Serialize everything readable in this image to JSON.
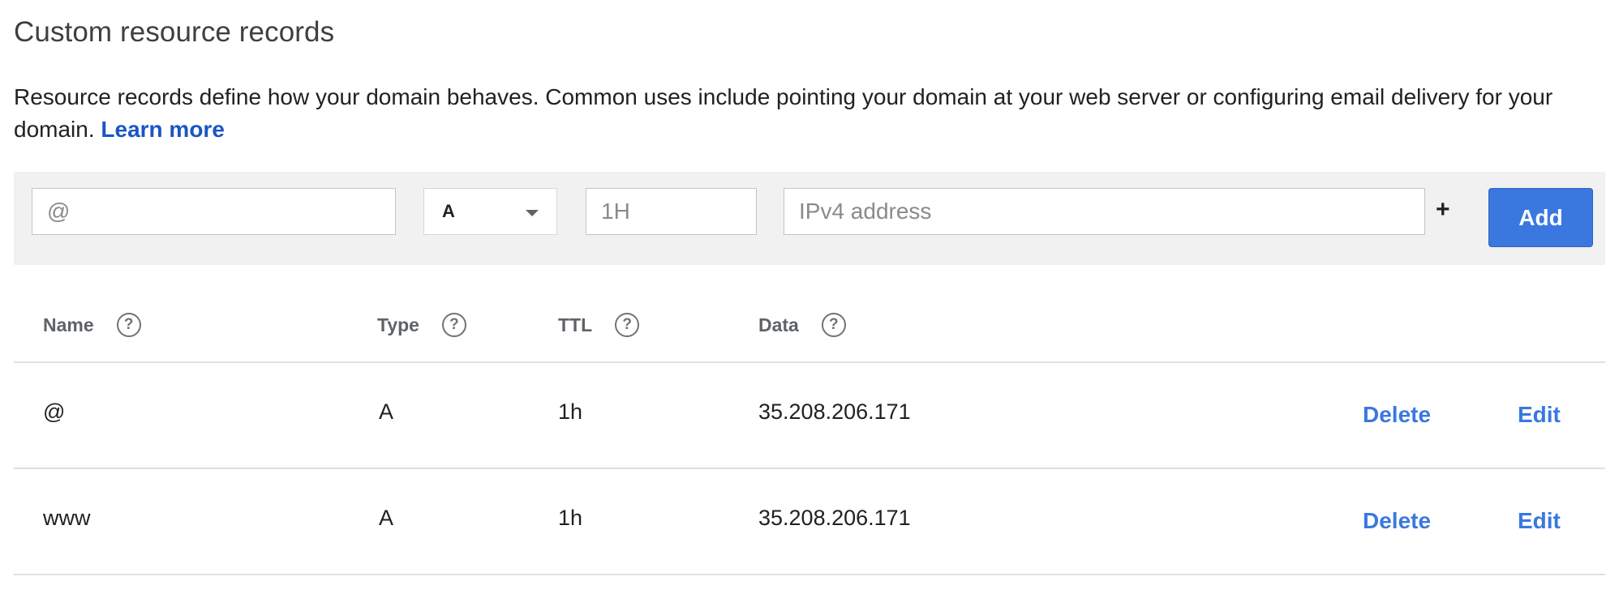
{
  "section": {
    "title": "Custom resource records",
    "description": "Resource records define how your domain behaves. Common uses include pointing your domain at your web server or configuring email delivery for your domain.",
    "learn_more": "Learn more"
  },
  "form": {
    "name_placeholder": "@",
    "type_selected": "A",
    "ttl_placeholder": "1H",
    "data_placeholder": "IPv4 address",
    "plus_label": "+",
    "add_label": "Add"
  },
  "table": {
    "headers": {
      "name": "Name",
      "type": "Type",
      "ttl": "TTL",
      "data": "Data",
      "help_glyph": "?"
    },
    "rows": [
      {
        "name": "@",
        "type": "A",
        "ttl": "1h",
        "data": "35.208.206.171",
        "delete": "Delete",
        "edit": "Edit"
      },
      {
        "name": "www",
        "type": "A",
        "ttl": "1h",
        "data": "35.208.206.171",
        "delete": "Delete",
        "edit": "Edit"
      }
    ]
  },
  "icons": {
    "help": "help-circle-icon",
    "dropdown": "caret-down-icon",
    "add_row": "plus-icon"
  },
  "colors": {
    "link": "#1a56c4",
    "action_link": "#3a78e0",
    "primary_button": "#3a78e0",
    "form_background": "#f1f1f1"
  }
}
